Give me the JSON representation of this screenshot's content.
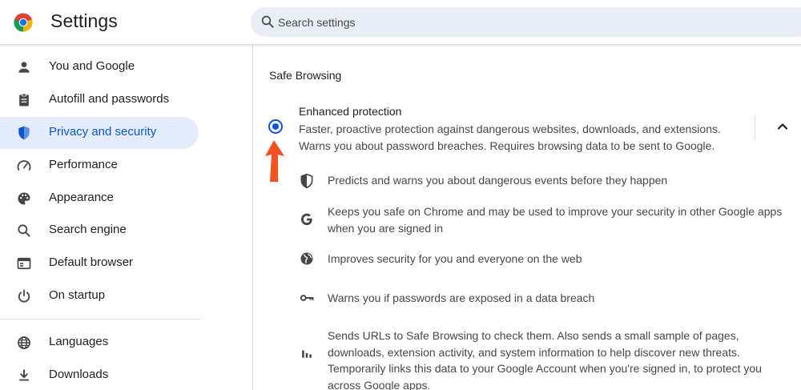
{
  "header": {
    "title": "Settings",
    "logo_icon": "chrome-logo-icon",
    "search": {
      "placeholder": "Search settings",
      "value": "",
      "icon": "search-icon"
    }
  },
  "sidebar": {
    "items": [
      {
        "label": "You and Google",
        "icon": "person-icon",
        "active": false
      },
      {
        "label": "Autofill and passwords",
        "icon": "clipboard-icon",
        "active": false
      },
      {
        "label": "Privacy and security",
        "icon": "shield-icon",
        "active": true
      },
      {
        "label": "Performance",
        "icon": "speedometer-icon",
        "active": false
      },
      {
        "label": "Appearance",
        "icon": "palette-icon",
        "active": false
      },
      {
        "label": "Search engine",
        "icon": "search-icon",
        "active": false
      },
      {
        "label": "Default browser",
        "icon": "browser-window-icon",
        "active": false
      },
      {
        "label": "On startup",
        "icon": "power-icon",
        "active": false
      },
      {
        "label": "Languages",
        "icon": "globe-icon",
        "active": false
      },
      {
        "label": "Downloads",
        "icon": "download-icon",
        "active": false
      }
    ]
  },
  "main": {
    "section_title": "Safe Browsing",
    "option": {
      "title": "Enhanced protection",
      "description": "Faster, proactive protection against dangerous websites, downloads, and extensions. Warns you about password breaches. Requires browsing data to be sent to Google.",
      "selected": true,
      "expanded": true
    },
    "features": [
      {
        "icon": "shield-half-icon",
        "text": "Predicts and warns you about dangerous events before they happen"
      },
      {
        "icon": "google-g-icon",
        "text": "Keeps you safe on Chrome and may be used to improve your security in other Google apps when you are signed in"
      },
      {
        "icon": "globe-icon",
        "text": "Improves security for you and everyone on the web"
      },
      {
        "icon": "key-icon",
        "text": "Warns you if passwords are exposed in a data breach"
      },
      {
        "icon": "bar-chart-icon",
        "text": "Sends URLs to Safe Browsing to check them. Also sends a small sample of pages, downloads, extension activity, and system information to help discover new threats. Temporarily links this data to your Google Account when you're signed in, to protect you across Google apps."
      }
    ]
  },
  "colors": {
    "accent": "#0b57d0",
    "active_nav_bg": "#e4ecfb",
    "search_bg": "#e9eef6",
    "annotation_arrow": "#f4511e"
  }
}
